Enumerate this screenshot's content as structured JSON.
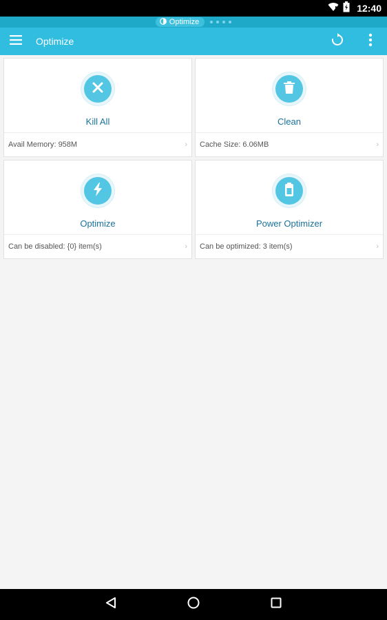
{
  "status_bar": {
    "time": "12:40"
  },
  "notification": {
    "label": "Optimize"
  },
  "app_bar": {
    "title": "Optimize"
  },
  "cards": [
    {
      "label": "Kill All",
      "info_label": "Avail Memory",
      "info_value": "958M"
    },
    {
      "label": "Clean",
      "info_label": "Cache Size",
      "info_value": "6.06MB"
    },
    {
      "label": "Optimize",
      "info_label": "Can be disabled",
      "info_value": "{0} item(s)"
    },
    {
      "label": "Power Optimizer",
      "info_label": "Can be optimized",
      "info_value": "3 item(s)"
    }
  ],
  "colors": {
    "app_bar": "#30bde0",
    "notif_strip": "#1fa9c9",
    "accent_text": "#19739b",
    "icon_fill": "#52c6e2"
  }
}
